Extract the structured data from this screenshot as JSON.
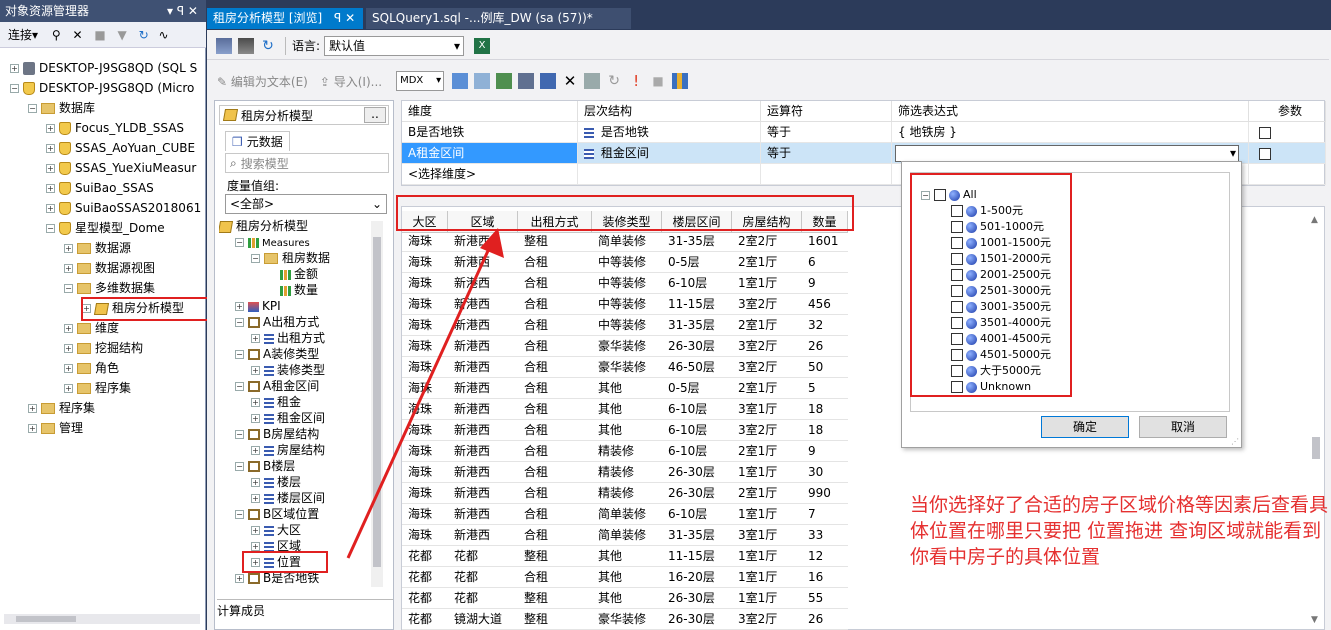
{
  "object_explorer": {
    "title": "对象资源管理器",
    "title_icons": "▾ ꟼ ✕",
    "connect_label": "连接▾",
    "nodes": [
      {
        "label": "DESKTOP-J9SG8QD (SQL S",
        "kind": "server",
        "expander": "+",
        "indent": 0
      },
      {
        "label": "DESKTOP-J9SG8QD (Micro",
        "kind": "ssas",
        "expander": "−",
        "indent": 0
      },
      {
        "label": "数据库",
        "kind": "folder",
        "expander": "−",
        "indent": 1
      },
      {
        "label": "Focus_YLDB_SSAS",
        "kind": "db",
        "expander": "+",
        "indent": 2
      },
      {
        "label": "SSAS_AoYuan_CUBE",
        "kind": "db",
        "expander": "+",
        "indent": 2
      },
      {
        "label": "SSAS_YueXiuMeasur",
        "kind": "db",
        "expander": "+",
        "indent": 2
      },
      {
        "label": "SuiBao_SSAS",
        "kind": "db",
        "expander": "+",
        "indent": 2
      },
      {
        "label": "SuiBaoSSAS2018061",
        "kind": "db",
        "expander": "+",
        "indent": 2
      },
      {
        "label": "星型模型_Dome",
        "kind": "db",
        "expander": "−",
        "indent": 2
      },
      {
        "label": "数据源",
        "kind": "folder",
        "expander": "+",
        "indent": 3
      },
      {
        "label": "数据源视图",
        "kind": "folder",
        "expander": "+",
        "indent": 3
      },
      {
        "label": "多维数据集",
        "kind": "folder",
        "expander": "−",
        "indent": 3
      },
      {
        "label": "租房分析模型",
        "kind": "cube",
        "expander": "+",
        "indent": 4
      },
      {
        "label": "维度",
        "kind": "folder",
        "expander": "+",
        "indent": 3
      },
      {
        "label": "挖掘结构",
        "kind": "folder",
        "expander": "+",
        "indent": 3
      },
      {
        "label": "角色",
        "kind": "folder",
        "expander": "+",
        "indent": 3
      },
      {
        "label": "程序集",
        "kind": "folder",
        "expander": "+",
        "indent": 3
      },
      {
        "label": "程序集",
        "kind": "folder",
        "expander": "+",
        "indent": 1
      },
      {
        "label": "管理",
        "kind": "folder",
        "expander": "+",
        "indent": 1
      }
    ]
  },
  "tabs": [
    {
      "label": "租房分析模型 [浏览]",
      "close": "ꟼ ✕"
    },
    {
      "label": "SQLQuery1.sql -...例库_DW (sa (57))*"
    }
  ],
  "toolbar1": {
    "language_label": "语言:",
    "language_value": "默认值"
  },
  "toolbar2": {
    "edit_as_text": "编辑为文本(E)",
    "import": "导入(I)...",
    "query_mode": "MDX"
  },
  "metadata": {
    "cube_name": "租房分析模型",
    "cube_button": "..",
    "tab": "元数据",
    "search_placeholder": "搜索模型",
    "measure_group_label": "度量值组:",
    "measure_group_value": "<全部>",
    "calc_members": "计算成员",
    "tree": [
      {
        "label": "租房分析模型",
        "kind": "cube",
        "indent": 0,
        "expander": ""
      },
      {
        "label": "Measures",
        "kind": "meas",
        "indent": 1,
        "expander": "−"
      },
      {
        "label": "租房数据",
        "kind": "folder",
        "indent": 2,
        "expander": "−"
      },
      {
        "label": "金额",
        "kind": "meas",
        "indent": 3,
        "expander": ""
      },
      {
        "label": "数量",
        "kind": "meas",
        "indent": 3,
        "expander": ""
      },
      {
        "label": "KPI",
        "kind": "kpi",
        "indent": 1,
        "expander": "+"
      },
      {
        "label": "A出租方式",
        "kind": "dim",
        "indent": 1,
        "expander": "−"
      },
      {
        "label": "出租方式",
        "kind": "hier",
        "indent": 2,
        "expander": "+"
      },
      {
        "label": "A装修类型",
        "kind": "dim",
        "indent": 1,
        "expander": "−"
      },
      {
        "label": "装修类型",
        "kind": "hier",
        "indent": 2,
        "expander": "+"
      },
      {
        "label": "A租金区间",
        "kind": "dim",
        "indent": 1,
        "expander": "−"
      },
      {
        "label": "租金",
        "kind": "hier",
        "indent": 2,
        "expander": "+"
      },
      {
        "label": "租金区间",
        "kind": "hier",
        "indent": 2,
        "expander": "+"
      },
      {
        "label": "B房屋结构",
        "kind": "dim",
        "indent": 1,
        "expander": "−"
      },
      {
        "label": "房屋结构",
        "kind": "hier",
        "indent": 2,
        "expander": "+"
      },
      {
        "label": "B楼层",
        "kind": "dim",
        "indent": 1,
        "expander": "−"
      },
      {
        "label": "楼层",
        "kind": "hier",
        "indent": 2,
        "expander": "+"
      },
      {
        "label": "楼层区间",
        "kind": "hier",
        "indent": 2,
        "expander": "+"
      },
      {
        "label": "B区域位置",
        "kind": "dim",
        "indent": 1,
        "expander": "−"
      },
      {
        "label": "大区",
        "kind": "hier",
        "indent": 2,
        "expander": "+"
      },
      {
        "label": "区域",
        "kind": "hier",
        "indent": 2,
        "expander": "+"
      },
      {
        "label": "位置",
        "kind": "hier",
        "indent": 2,
        "expander": "+"
      },
      {
        "label": "B是否地铁",
        "kind": "dim",
        "indent": 1,
        "expander": "+"
      }
    ]
  },
  "filter": {
    "headers": [
      "维度",
      "层次结构",
      "运算符",
      "筛选表达式",
      "参数"
    ],
    "rows": [
      {
        "dimension": "B是否地铁",
        "hierarchy": "是否地铁",
        "operator": "等于",
        "expression": "{ 地铁房 }"
      },
      {
        "dimension": "A租金区间",
        "hierarchy": "租金区间",
        "operator": "等于",
        "expression": ""
      },
      {
        "dimension": "<选择维度>",
        "hierarchy": "",
        "operator": "",
        "expression": ""
      }
    ]
  },
  "results": {
    "headers": [
      "大区",
      "区域",
      "出租方式",
      "装修类型",
      "楼层区间",
      "房屋结构",
      "数量"
    ],
    "rows": [
      [
        "海珠",
        "新港西",
        "整租",
        "简单装修",
        "31-35层",
        "2室2厅",
        "1601"
      ],
      [
        "海珠",
        "新港西",
        "合租",
        "中等装修",
        "0-5层",
        "2室1厅",
        "6"
      ],
      [
        "海珠",
        "新港西",
        "合租",
        "中等装修",
        "6-10层",
        "1室1厅",
        "9"
      ],
      [
        "海珠",
        "新港西",
        "合租",
        "中等装修",
        "11-15层",
        "3室2厅",
        "456"
      ],
      [
        "海珠",
        "新港西",
        "合租",
        "中等装修",
        "31-35层",
        "2室1厅",
        "32"
      ],
      [
        "海珠",
        "新港西",
        "合租",
        "豪华装修",
        "26-30层",
        "3室2厅",
        "26"
      ],
      [
        "海珠",
        "新港西",
        "合租",
        "豪华装修",
        "46-50层",
        "3室2厅",
        "50"
      ],
      [
        "海珠",
        "新港西",
        "合租",
        "其他",
        "0-5层",
        "2室1厅",
        "5"
      ],
      [
        "海珠",
        "新港西",
        "合租",
        "其他",
        "6-10层",
        "3室1厅",
        "18"
      ],
      [
        "海珠",
        "新港西",
        "合租",
        "其他",
        "6-10层",
        "3室2厅",
        "18"
      ],
      [
        "海珠",
        "新港西",
        "合租",
        "精装修",
        "6-10层",
        "2室1厅",
        "9"
      ],
      [
        "海珠",
        "新港西",
        "合租",
        "精装修",
        "26-30层",
        "1室1厅",
        "30"
      ],
      [
        "海珠",
        "新港西",
        "合租",
        "精装修",
        "26-30层",
        "2室1厅",
        "990"
      ],
      [
        "海珠",
        "新港西",
        "合租",
        "简单装修",
        "6-10层",
        "1室1厅",
        "7"
      ],
      [
        "海珠",
        "新港西",
        "合租",
        "简单装修",
        "31-35层",
        "3室1厅",
        "33"
      ],
      [
        "花都",
        "花都",
        "整租",
        "其他",
        "11-15层",
        "1室1厅",
        "12"
      ],
      [
        "花都",
        "花都",
        "合租",
        "其他",
        "16-20层",
        "1室1厅",
        "16"
      ],
      [
        "花都",
        "花都",
        "整租",
        "其他",
        "26-30层",
        "1室1厅",
        "55"
      ],
      [
        "花都",
        "镜湖大道",
        "整租",
        "豪华装修",
        "26-30层",
        "3室2厅",
        "26"
      ]
    ]
  },
  "dropdown": {
    "items": [
      "All",
      "1-500元",
      "501-1000元",
      "1001-1500元",
      "1501-2000元",
      "2001-2500元",
      "2501-3000元",
      "3001-3500元",
      "3501-4000元",
      "4001-4500元",
      "4501-5000元",
      "大于5000元",
      "Unknown"
    ],
    "ok": "确定",
    "cancel": "取消"
  },
  "annotation": "当你选择好了合适的房子区域价格等因素后查看具体位置在哪里只要把 位置拖进 查询区域就能看到你看中房子的具体位置",
  "colors": {
    "accent": "#007acc",
    "highlight": "#cce4f7",
    "annotation_red": "#e02020"
  }
}
